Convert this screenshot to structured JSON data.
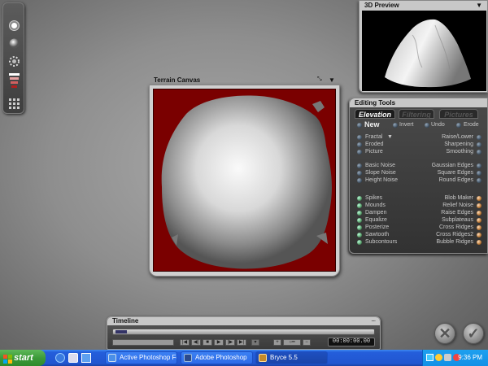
{
  "palette": {
    "tools": [
      "render-sphere",
      "render-sphere-small",
      "dotted-sphere",
      "gradient-bars",
      "grid"
    ]
  },
  "preview": {
    "title": "3D Preview"
  },
  "canvas": {
    "title": "Terrain Canvas"
  },
  "tools": {
    "title": "Editing Tools",
    "tabs": [
      "Elevation",
      "Filtering",
      "Pictures"
    ],
    "top_row": {
      "new": "New",
      "invert": "Invert",
      "undo": "Undo",
      "erode": "Erode"
    },
    "left_items": [
      "Fractal",
      "Eroded",
      "Picture",
      "Basic Noise",
      "Slope Noise",
      "Height Noise",
      "Spikes",
      "Mounds",
      "Dampen",
      "Equalize",
      "Posterize",
      "Sawtooth",
      "Subcontours"
    ],
    "right_items": [
      "Raise/Lower",
      "Sharpening",
      "Smoothing",
      "Gaussian Edges",
      "Square Edges",
      "Round Edges",
      "Blob Maker",
      "Relief Noise",
      "Raise Edges",
      "Subplateaus",
      "Cross Ridges",
      "Cross Ridges2",
      "Bubble Ridges"
    ]
  },
  "timeline": {
    "title": "Timeline",
    "timecode": "00:00:00.00"
  },
  "actions": {
    "cancel": "✕",
    "accept": "✓"
  },
  "taskbar": {
    "start": "start",
    "tasks": [
      "Active Photoshop For...",
      "Adobe Photoshop",
      "Bryce 5.5"
    ],
    "clock": "9:36 PM"
  },
  "colors": {
    "taskbar": "#245edb",
    "start": "#3c9a39",
    "canvas_bg": "#7a0000"
  }
}
